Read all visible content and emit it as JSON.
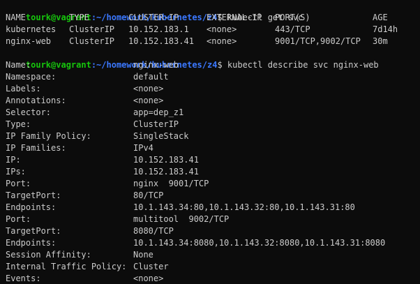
{
  "prompt1": {
    "user": "tourk@vagrant",
    "path": ":~/homework/kubernetes/z4",
    "symbol": "$",
    "command": " kubectl get svc"
  },
  "svc_table": {
    "headers": [
      "NAME",
      "TYPE",
      "CLUSTER-IP",
      "EXTERNAL-IP",
      "PORT(S)",
      "AGE"
    ],
    "rows": [
      [
        "kubernetes",
        "ClusterIP",
        "10.152.183.1",
        "<none>",
        "443/TCP",
        "7d14h"
      ],
      [
        "nginx-web",
        "ClusterIP",
        "10.152.183.41",
        "<none>",
        "9001/TCP,9002/TCP",
        "30m"
      ]
    ]
  },
  "prompt2": {
    "user": "tourk@vagrant",
    "path": ":~/homework/kubernetes/z4",
    "symbol": "$",
    "command": " kubectl describe svc nginx-web"
  },
  "describe": [
    {
      "key": "Name:",
      "value": "nginx-web"
    },
    {
      "key": "Namespace:",
      "value": "default"
    },
    {
      "key": "Labels:",
      "value": "<none>"
    },
    {
      "key": "Annotations:",
      "value": "<none>"
    },
    {
      "key": "Selector:",
      "value": "app=dep_z1"
    },
    {
      "key": "Type:",
      "value": "ClusterIP"
    },
    {
      "key": "IP Family Policy:",
      "value": "SingleStack"
    },
    {
      "key": "IP Families:",
      "value": "IPv4"
    },
    {
      "key": "IP:",
      "value": "10.152.183.41"
    },
    {
      "key": "IPs:",
      "value": "10.152.183.41"
    },
    {
      "key": "Port:",
      "value": "nginx  9001/TCP"
    },
    {
      "key": "TargetPort:",
      "value": "80/TCP"
    },
    {
      "key": "Endpoints:",
      "value": "10.1.143.34:80,10.1.143.32:80,10.1.143.31:80"
    },
    {
      "key": "Port:",
      "value": "multitool  9002/TCP"
    },
    {
      "key": "TargetPort:",
      "value": "8080/TCP"
    },
    {
      "key": "Endpoints:",
      "value": "10.1.143.34:8080,10.1.143.32:8080,10.1.143.31:8080"
    },
    {
      "key": "Session Affinity:",
      "value": "None"
    },
    {
      "key": "Internal Traffic Policy:",
      "value": "Cluster"
    },
    {
      "key": "Events:",
      "value": "<none>"
    }
  ],
  "colors": {
    "background": "#0c0c0c",
    "text": "#cccccc",
    "user": "#16c60c",
    "path": "#3b78ff"
  }
}
